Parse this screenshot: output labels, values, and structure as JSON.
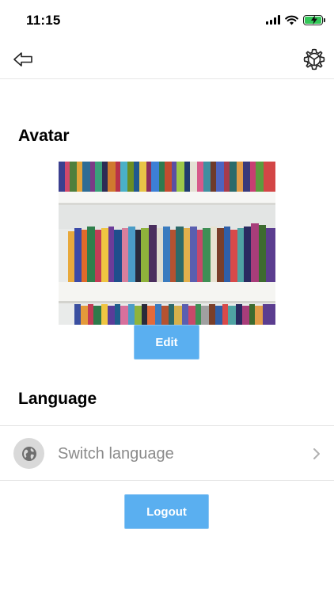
{
  "status_bar": {
    "time": "11:15",
    "battery_color": "#34c759"
  },
  "nav": {
    "back_icon": "back-arrow-icon",
    "settings_icon": "gear-icon"
  },
  "avatar": {
    "title": "Avatar",
    "image_description_icon": "avatar-image",
    "edit_label": "Edit"
  },
  "language": {
    "title": "Language",
    "switch_label": "Switch language",
    "icon": "globe-icon"
  },
  "logout_label": "Logout",
  "colors": {
    "accent": "#5aaff0",
    "muted_text": "#8a8a8a",
    "divider": "#e3e3e3"
  }
}
